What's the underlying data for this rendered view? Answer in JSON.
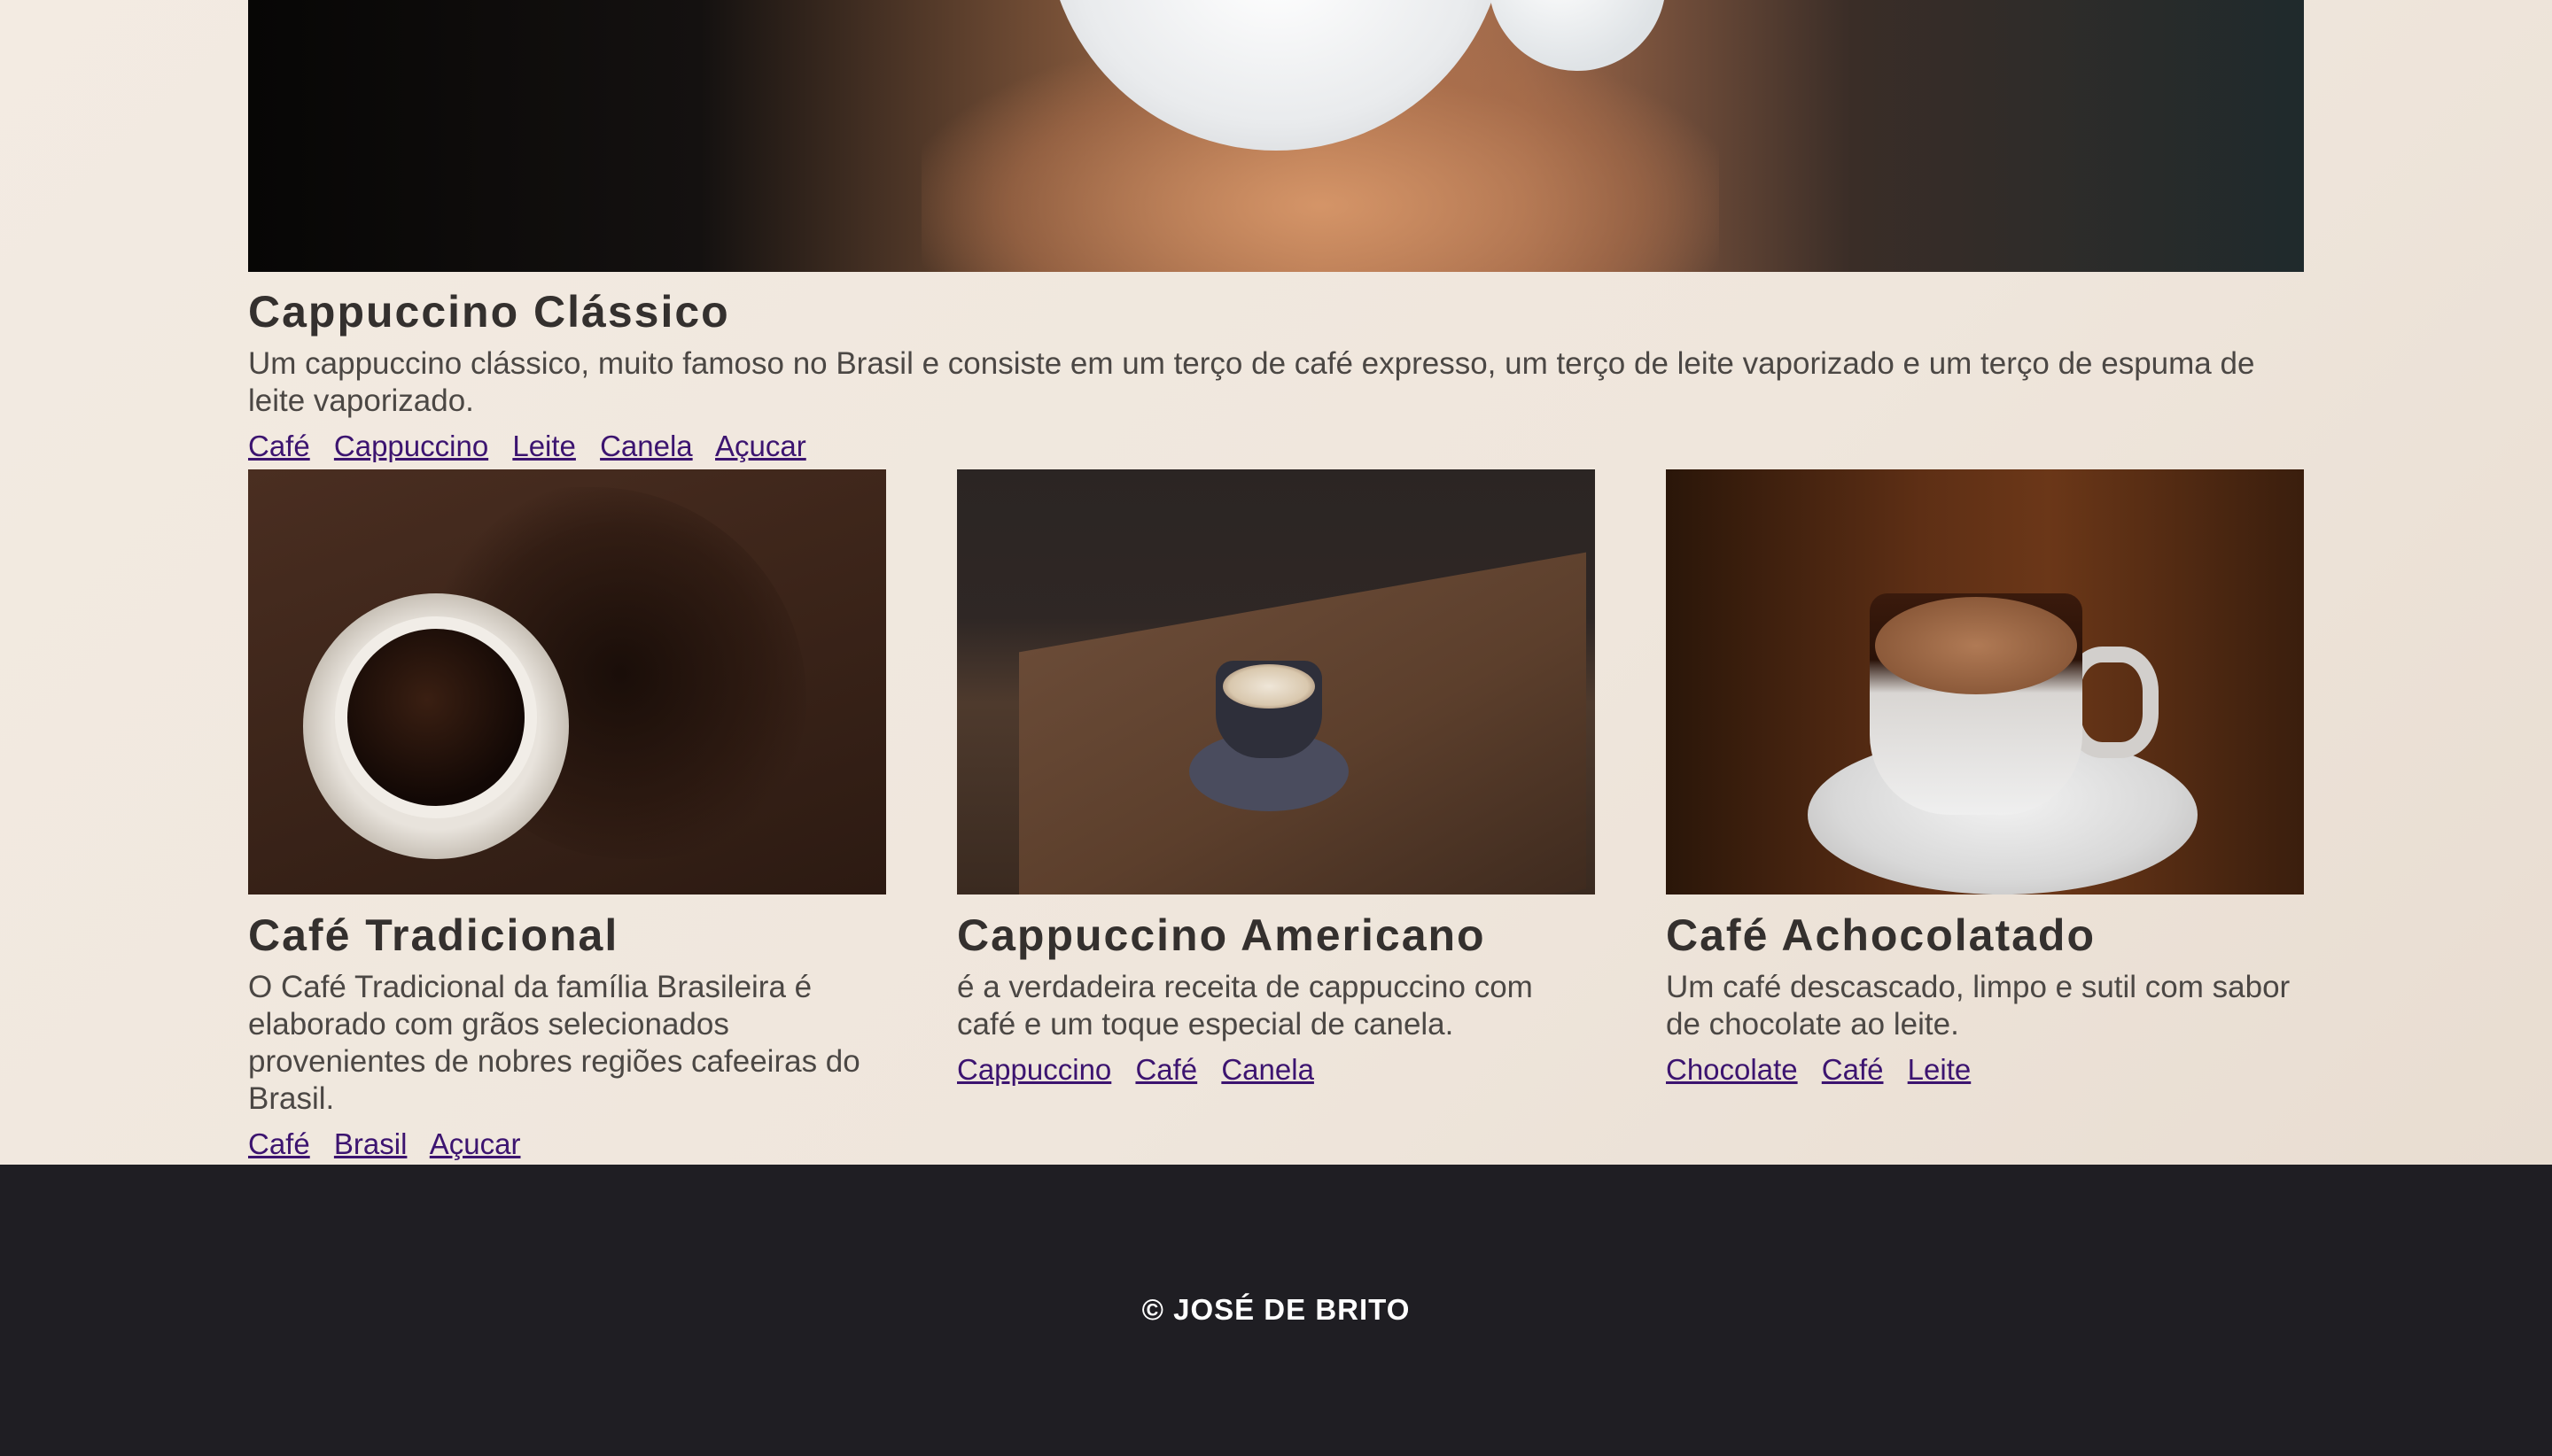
{
  "featured": {
    "title": "Cappuccino Clássico",
    "description": "Um cappuccino clássico, muito famoso no Brasil e consiste em um terço de café expresso, um terço de leite vaporizado e um terço de espuma de leite vaporizado.",
    "tags": [
      "Café",
      "Cappuccino",
      "Leite",
      "Canela",
      "Açucar"
    ]
  },
  "cards": [
    {
      "title": "Café Tradicional",
      "description": "O Café Tradicional da família Brasileira é elaborado com grãos selecionados provenientes de nobres regiões cafeeiras do Brasil.",
      "tags": [
        "Café",
        "Brasil",
        "Açucar"
      ]
    },
    {
      "title": "Cappuccino Americano",
      "description": "é a verdadeira receita de cappuccino com café e um toque especial de canela.",
      "tags": [
        "Cappuccino",
        "Café",
        "Canela"
      ]
    },
    {
      "title": "Café Achocolatado",
      "description": "Um café descascado, limpo e sutil com sabor de chocolate ao leite.",
      "tags": [
        "Chocolate",
        "Café",
        "Leite"
      ]
    }
  ],
  "footer": {
    "copyright": "© JOSÉ DE BRITO"
  },
  "colors": {
    "background": "#f0e7dd",
    "link": "#3c1470",
    "footer_bg": "#1f1e23",
    "title": "#34302e"
  }
}
